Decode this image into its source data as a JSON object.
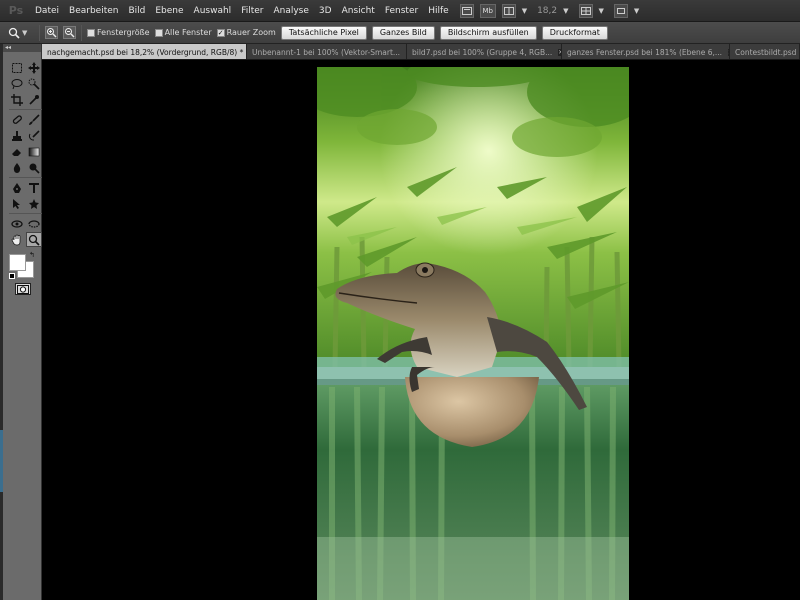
{
  "app": {
    "logo": "Ps"
  },
  "menu": [
    "Datei",
    "Bearbeiten",
    "Bild",
    "Ebene",
    "Auswahl",
    "Filter",
    "Analyse",
    "3D",
    "Ansicht",
    "Fenster",
    "Hilfe"
  ],
  "menubar_right": {
    "mb_label": "Mb",
    "zoom_value": "18,2"
  },
  "options": {
    "checkbox_fenstergroesse": {
      "label": "Fenstergröße",
      "checked": false
    },
    "checkbox_alle_fenster": {
      "label": "Alle Fenster",
      "checked": false
    },
    "checkbox_rauer_zoom": {
      "label": "Rauer Zoom",
      "checked": true
    },
    "buttons": [
      "Tatsächliche Pixel",
      "Ganzes Bild",
      "Bildschirm ausfüllen",
      "Druckformat"
    ]
  },
  "tabs": [
    {
      "label": "nachgemacht.psd bei 18,2% (Vordergrund, RGB/8) *",
      "active": true
    },
    {
      "label": "Unbenannt-1 bei 100% (Vektor-Smart...",
      "active": false
    },
    {
      "label": "bild7.psd bei 100% (Gruppe 4, RGB...",
      "active": false
    },
    {
      "label": "ganzes Fenster.psd bei 181% (Ebene 6,...",
      "active": false
    },
    {
      "label": "Contestbildt.psd",
      "active": false
    }
  ],
  "colors": {
    "foreground": "#ffffff",
    "background": "#ffffff"
  },
  "theme": {
    "accent": "#3b6e8e"
  }
}
